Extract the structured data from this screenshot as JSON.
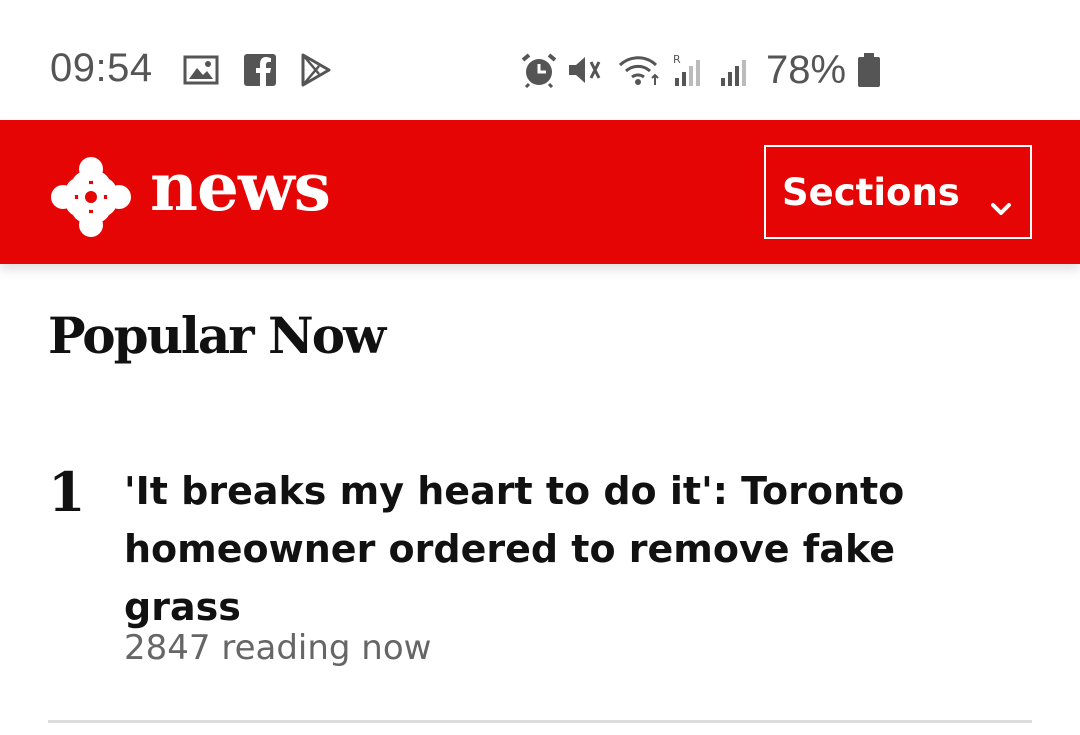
{
  "status_bar": {
    "time": "09:54",
    "left_icons": [
      "image-icon",
      "facebook-icon",
      "play-store-icon"
    ],
    "right_icons": [
      "alarm-icon",
      "mute-icon",
      "wifi-icon",
      "signal-roaming-icon",
      "signal-icon"
    ],
    "battery_text": "78%",
    "battery_icon": "battery-icon"
  },
  "header": {
    "brand": "news",
    "logo_icon": "cbc-gem-icon",
    "sections_label": "Sections",
    "accent_color": "#e60505"
  },
  "main": {
    "section_title": "Popular Now",
    "items": [
      {
        "rank": "1",
        "headline": "'It breaks my heart to do it': Toronto homeowner ordered to remove fake grass",
        "meta": "2847 reading now"
      }
    ]
  }
}
